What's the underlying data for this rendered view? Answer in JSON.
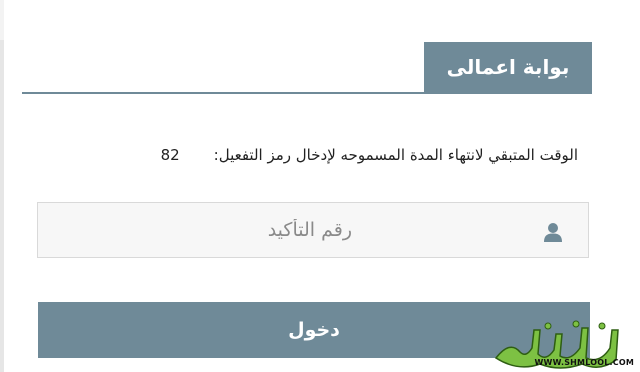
{
  "header": {
    "title": "بوابة اعمالى"
  },
  "countdown": {
    "label": "الوقت المتبقي لانتهاء المدة المسموحه لإدخال رمز التفعيل:",
    "value": "82"
  },
  "code_input": {
    "placeholder": "رقم التأكيد",
    "value": "",
    "icon": "user-icon"
  },
  "login_button": {
    "label": "دخول"
  },
  "watermark": {
    "logo_text": "شملول",
    "url": "WWW.SHMLOOL.COM"
  },
  "colors": {
    "accent": "#6f8a98",
    "watermark_green": "#7dc143"
  }
}
